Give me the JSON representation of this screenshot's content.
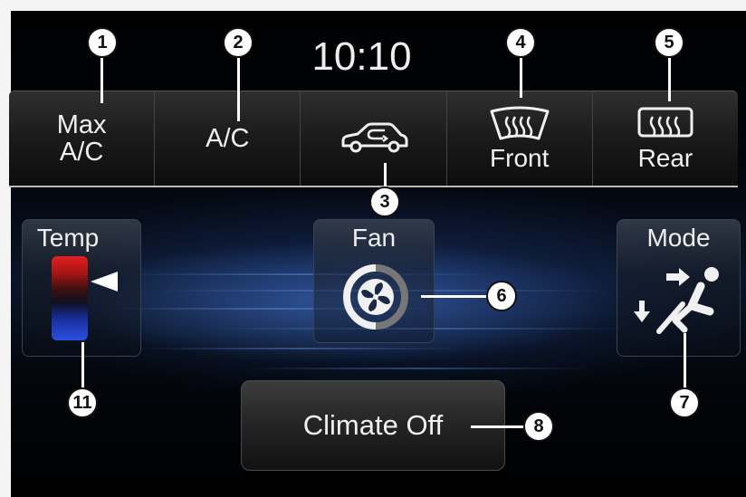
{
  "clock": "10:10",
  "top_buttons": [
    {
      "label": "Max\nA/C"
    },
    {
      "label": "A/C"
    },
    {
      "label": "",
      "icon": "recirculation-car-icon"
    },
    {
      "label": "Front",
      "icon": "front-defrost-icon"
    },
    {
      "label": "Rear",
      "icon": "rear-defrost-icon"
    }
  ],
  "temp": {
    "title": "Temp"
  },
  "fan": {
    "title": "Fan",
    "icon": "fan-icon"
  },
  "mode": {
    "title": "Mode",
    "icon": "seated-person-airflow-icon"
  },
  "climate_off": {
    "label": "Climate Off"
  },
  "callouts": [
    "1",
    "2",
    "3",
    "4",
    "5",
    "6",
    "7",
    "8",
    "11"
  ],
  "colors": {
    "background": "#000000",
    "accent_blue": "#2a50e0",
    "accent_red": "#e02020",
    "text": "#f0f0f0"
  }
}
